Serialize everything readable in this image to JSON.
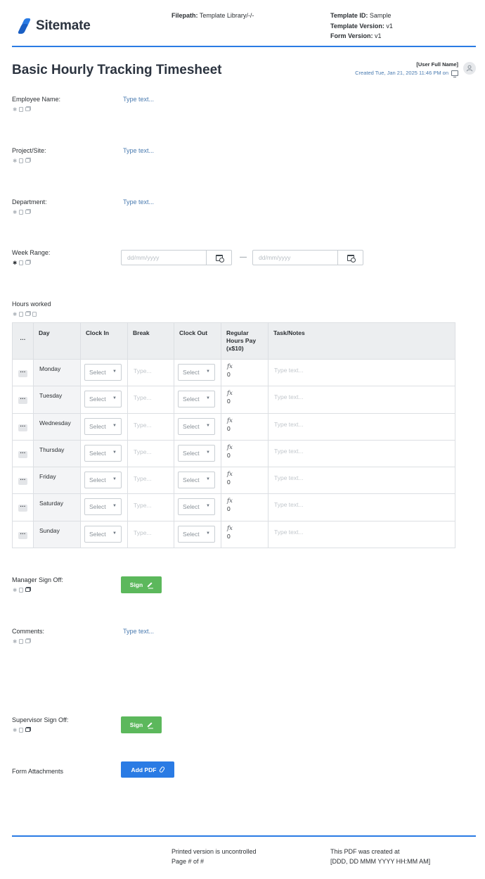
{
  "header": {
    "logo_text": "Sitemate",
    "filepath_label": "Filepath:",
    "filepath_value": "Template Library/-/-",
    "template_id_label": "Template ID:",
    "template_id_value": "Sample",
    "template_version_label": "Template Version:",
    "template_version_value": "v1",
    "form_version_label": "Form Version:",
    "form_version_value": "v1",
    "brand_color": "#2a7be4"
  },
  "form": {
    "title": "Basic Hourly Tracking Timesheet",
    "user_full_name": "[User Full Name]",
    "created_text": "Created Tue, Jan 21, 2025 11:46 PM on"
  },
  "fields": {
    "employee_name": {
      "label": "Employee Name:",
      "placeholder": "Type text..."
    },
    "project_site": {
      "label": "Project/Site:",
      "placeholder": "Type text..."
    },
    "department": {
      "label": "Department:",
      "placeholder": "Type text..."
    },
    "week_range": {
      "label": "Week Range:",
      "start_placeholder": "dd/mm/yyyy",
      "end_placeholder": "dd/mm/yyyy",
      "separator": "—"
    },
    "hours_worked": {
      "label": "Hours worked"
    },
    "manager_sign_off": {
      "label": "Manager Sign Off:",
      "button": "Sign"
    },
    "comments": {
      "label": "Comments:",
      "placeholder": "Type text..."
    },
    "supervisor_sign_off": {
      "label": "Supervisor Sign Off:",
      "button": "Sign"
    },
    "form_attachments": {
      "label": "Form Attachments",
      "button": "Add PDF"
    }
  },
  "hours_table": {
    "menu_glyph": "···",
    "columns": [
      "Day",
      "Clock In",
      "Break",
      "Clock Out",
      "Regular Hours Pay (x$10)",
      "Task/Notes"
    ],
    "select_placeholder": "Select",
    "break_placeholder": "Type...",
    "notes_placeholder": "Type text...",
    "formula_glyph": "fx",
    "rows": [
      {
        "day": "Monday",
        "pay": "0"
      },
      {
        "day": "Tuesday",
        "pay": "0"
      },
      {
        "day": "Wednesday",
        "pay": "0"
      },
      {
        "day": "Thursday",
        "pay": "0"
      },
      {
        "day": "Friday",
        "pay": "0"
      },
      {
        "day": "Saturday",
        "pay": "0"
      },
      {
        "day": "Sunday",
        "pay": "0"
      }
    ]
  },
  "footer": {
    "printed_notice": "Printed version is uncontrolled",
    "page_text": "Page # of #",
    "created_at_label": "This PDF was created at",
    "created_at_value": "[DDD, DD MMM YYYY HH:MM AM]"
  },
  "colors": {
    "sign_button": "#5cb85c",
    "add_pdf_button": "#2a7be4",
    "placeholder_link": "#4a7bb0"
  }
}
